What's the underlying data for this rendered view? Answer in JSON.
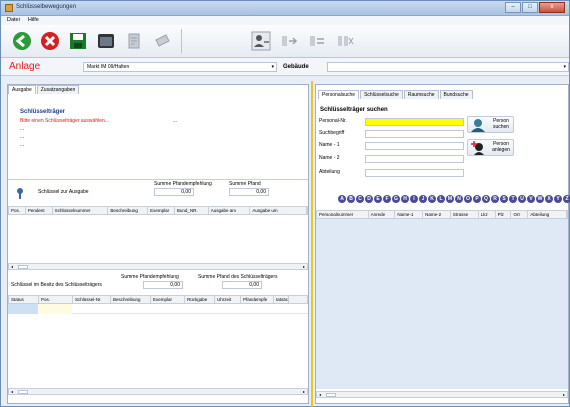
{
  "window": {
    "title": "Schlüsselbewegungen",
    "buttons": [
      "–",
      "□",
      "x"
    ]
  },
  "menu": [
    "Datei",
    "Hilfe"
  ],
  "anlage": {
    "label": "Anlage",
    "selected": "Markt IM 09/Halten",
    "gebaeude_label": "Gebäude",
    "gebaeude_value": ""
  },
  "left": {
    "tabs": [
      "Ausgabe",
      "Zusatzangaben"
    ],
    "schluesseltraeger_title": "Schlüsselträger",
    "hint": "Bitte einen Schlüsselträger auswählen...",
    "placeholder_lines": [
      "...",
      "...",
      "..."
    ],
    "ausgabe_label": "Schlüssel zur Ausgabe",
    "sum_pfand_empf_label": "Summe Pfandempfehlung",
    "sum_pfand_label": "Summe Pfand",
    "sum_pfand_empf_value": "0,00",
    "sum_pfand_value": "0,00",
    "ausgabe_columns": [
      "Pos.",
      "Pendent",
      "Schlüsselnummer",
      "Beschreibung",
      "Exemplar",
      "Bund_NR.",
      "Ausgabe am",
      "Ausgabe um"
    ],
    "besitz_label": "Schlüssel im Besitz des Schlüsselträgers",
    "sum_pfand_empf2_label": "Summe Pfandempfehlung",
    "sum_pfand2_label": "Summe Pfand des Schlüsselträgers",
    "sum_pfand_empf2_value": "0,00",
    "sum_pfand2_value": "0,00",
    "besitz_columns": [
      "Status",
      "Pos.",
      "Schlüssel-Nr.",
      "Beschreibung",
      "Exemplar",
      "Rückgabe",
      "Uhrzeit",
      "Pfandempfe",
      "tatsäc"
    ]
  },
  "right": {
    "tabs": [
      "Personalsuche",
      "Schlüsselsuche",
      "Raumsuche",
      "Bundsuche"
    ],
    "title": "Schlüsselträger suchen",
    "fields": [
      "Personal-Nr.",
      "Suchbegriff",
      "Name - 1",
      "Name - 2",
      "Abteilung"
    ],
    "person_suchen": "Person suchen",
    "person_anlegen": "Person anlegen",
    "letters": [
      "A",
      "B",
      "C",
      "D",
      "E",
      "F",
      "G",
      "H",
      "I",
      "J",
      "K",
      "L",
      "M",
      "N",
      "O",
      "P",
      "Q",
      "R",
      "S",
      "T",
      "U",
      "V",
      "W",
      "X",
      "Y",
      "Z"
    ],
    "columns": [
      "Personalnummer",
      "Anrede",
      "Name-1",
      "Name-2",
      "Strasse",
      "Lkz",
      "Plz",
      "Ort",
      "Abteilung"
    ]
  },
  "colors": {
    "accent_red": "#e01c1c",
    "highlight_yellow": "#ffff00",
    "divider_yellow": "#e8c81a"
  }
}
